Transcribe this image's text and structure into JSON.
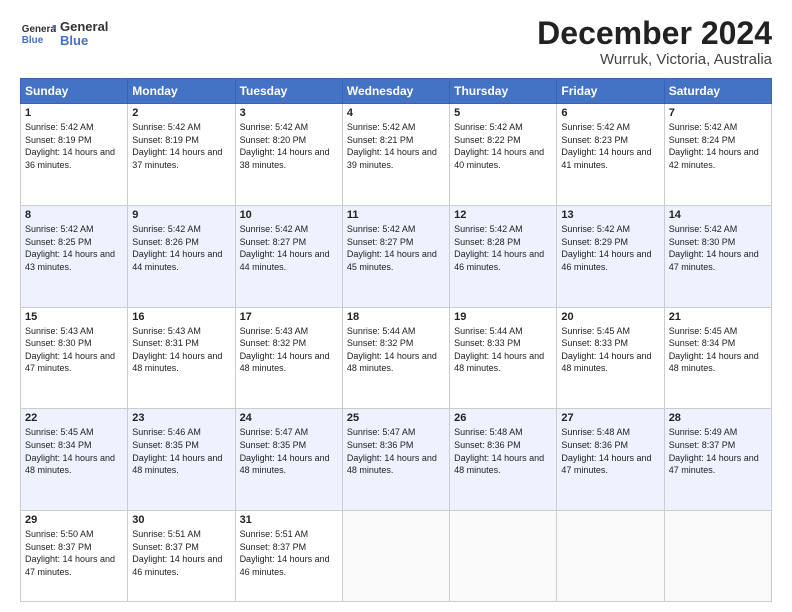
{
  "header": {
    "logo_general": "General",
    "logo_blue": "Blue",
    "title": "December 2024",
    "subtitle": "Wurruk, Victoria, Australia"
  },
  "calendar": {
    "headers": [
      "Sunday",
      "Monday",
      "Tuesday",
      "Wednesday",
      "Thursday",
      "Friday",
      "Saturday"
    ],
    "weeks": [
      [
        null,
        null,
        {
          "day": "3",
          "sunrise": "Sunrise: 5:42 AM",
          "sunset": "Sunset: 8:20 PM",
          "daylight": "Daylight: 14 hours and 38 minutes."
        },
        {
          "day": "4",
          "sunrise": "Sunrise: 5:42 AM",
          "sunset": "Sunset: 8:21 PM",
          "daylight": "Daylight: 14 hours and 39 minutes."
        },
        {
          "day": "5",
          "sunrise": "Sunrise: 5:42 AM",
          "sunset": "Sunset: 8:22 PM",
          "daylight": "Daylight: 14 hours and 40 minutes."
        },
        {
          "day": "6",
          "sunrise": "Sunrise: 5:42 AM",
          "sunset": "Sunset: 8:23 PM",
          "daylight": "Daylight: 14 hours and 41 minutes."
        },
        {
          "day": "7",
          "sunrise": "Sunrise: 5:42 AM",
          "sunset": "Sunset: 8:24 PM",
          "daylight": "Daylight: 14 hours and 42 minutes."
        }
      ],
      [
        {
          "day": "1",
          "sunrise": "Sunrise: 5:42 AM",
          "sunset": "Sunset: 8:19 PM",
          "daylight": "Daylight: 14 hours and 36 minutes."
        },
        {
          "day": "2",
          "sunrise": "Sunrise: 5:42 AM",
          "sunset": "Sunset: 8:19 PM",
          "daylight": "Daylight: 14 hours and 37 minutes."
        },
        {
          "day": "3",
          "sunrise": "Sunrise: 5:42 AM",
          "sunset": "Sunset: 8:20 PM",
          "daylight": "Daylight: 14 hours and 38 minutes."
        },
        {
          "day": "4",
          "sunrise": "Sunrise: 5:42 AM",
          "sunset": "Sunset: 8:21 PM",
          "daylight": "Daylight: 14 hours and 39 minutes."
        },
        {
          "day": "5",
          "sunrise": "Sunrise: 5:42 AM",
          "sunset": "Sunset: 8:22 PM",
          "daylight": "Daylight: 14 hours and 40 minutes."
        },
        {
          "day": "6",
          "sunrise": "Sunrise: 5:42 AM",
          "sunset": "Sunset: 8:23 PM",
          "daylight": "Daylight: 14 hours and 41 minutes."
        },
        {
          "day": "7",
          "sunrise": "Sunrise: 5:42 AM",
          "sunset": "Sunset: 8:24 PM",
          "daylight": "Daylight: 14 hours and 42 minutes."
        }
      ],
      [
        {
          "day": "8",
          "sunrise": "Sunrise: 5:42 AM",
          "sunset": "Sunset: 8:25 PM",
          "daylight": "Daylight: 14 hours and 43 minutes."
        },
        {
          "day": "9",
          "sunrise": "Sunrise: 5:42 AM",
          "sunset": "Sunset: 8:26 PM",
          "daylight": "Daylight: 14 hours and 44 minutes."
        },
        {
          "day": "10",
          "sunrise": "Sunrise: 5:42 AM",
          "sunset": "Sunset: 8:27 PM",
          "daylight": "Daylight: 14 hours and 44 minutes."
        },
        {
          "day": "11",
          "sunrise": "Sunrise: 5:42 AM",
          "sunset": "Sunset: 8:27 PM",
          "daylight": "Daylight: 14 hours and 45 minutes."
        },
        {
          "day": "12",
          "sunrise": "Sunrise: 5:42 AM",
          "sunset": "Sunset: 8:28 PM",
          "daylight": "Daylight: 14 hours and 46 minutes."
        },
        {
          "day": "13",
          "sunrise": "Sunrise: 5:42 AM",
          "sunset": "Sunset: 8:29 PM",
          "daylight": "Daylight: 14 hours and 46 minutes."
        },
        {
          "day": "14",
          "sunrise": "Sunrise: 5:42 AM",
          "sunset": "Sunset: 8:30 PM",
          "daylight": "Daylight: 14 hours and 47 minutes."
        }
      ],
      [
        {
          "day": "15",
          "sunrise": "Sunrise: 5:43 AM",
          "sunset": "Sunset: 8:30 PM",
          "daylight": "Daylight: 14 hours and 47 minutes."
        },
        {
          "day": "16",
          "sunrise": "Sunrise: 5:43 AM",
          "sunset": "Sunset: 8:31 PM",
          "daylight": "Daylight: 14 hours and 48 minutes."
        },
        {
          "day": "17",
          "sunrise": "Sunrise: 5:43 AM",
          "sunset": "Sunset: 8:32 PM",
          "daylight": "Daylight: 14 hours and 48 minutes."
        },
        {
          "day": "18",
          "sunrise": "Sunrise: 5:44 AM",
          "sunset": "Sunset: 8:32 PM",
          "daylight": "Daylight: 14 hours and 48 minutes."
        },
        {
          "day": "19",
          "sunrise": "Sunrise: 5:44 AM",
          "sunset": "Sunset: 8:33 PM",
          "daylight": "Daylight: 14 hours and 48 minutes."
        },
        {
          "day": "20",
          "sunrise": "Sunrise: 5:45 AM",
          "sunset": "Sunset: 8:33 PM",
          "daylight": "Daylight: 14 hours and 48 minutes."
        },
        {
          "day": "21",
          "sunrise": "Sunrise: 5:45 AM",
          "sunset": "Sunset: 8:34 PM",
          "daylight": "Daylight: 14 hours and 48 minutes."
        }
      ],
      [
        {
          "day": "22",
          "sunrise": "Sunrise: 5:45 AM",
          "sunset": "Sunset: 8:34 PM",
          "daylight": "Daylight: 14 hours and 48 minutes."
        },
        {
          "day": "23",
          "sunrise": "Sunrise: 5:46 AM",
          "sunset": "Sunset: 8:35 PM",
          "daylight": "Daylight: 14 hours and 48 minutes."
        },
        {
          "day": "24",
          "sunrise": "Sunrise: 5:47 AM",
          "sunset": "Sunset: 8:35 PM",
          "daylight": "Daylight: 14 hours and 48 minutes."
        },
        {
          "day": "25",
          "sunrise": "Sunrise: 5:47 AM",
          "sunset": "Sunset: 8:36 PM",
          "daylight": "Daylight: 14 hours and 48 minutes."
        },
        {
          "day": "26",
          "sunrise": "Sunrise: 5:48 AM",
          "sunset": "Sunset: 8:36 PM",
          "daylight": "Daylight: 14 hours and 48 minutes."
        },
        {
          "day": "27",
          "sunrise": "Sunrise: 5:48 AM",
          "sunset": "Sunset: 8:36 PM",
          "daylight": "Daylight: 14 hours and 47 minutes."
        },
        {
          "day": "28",
          "sunrise": "Sunrise: 5:49 AM",
          "sunset": "Sunset: 8:37 PM",
          "daylight": "Daylight: 14 hours and 47 minutes."
        }
      ],
      [
        {
          "day": "29",
          "sunrise": "Sunrise: 5:50 AM",
          "sunset": "Sunset: 8:37 PM",
          "daylight": "Daylight: 14 hours and 47 minutes."
        },
        {
          "day": "30",
          "sunrise": "Sunrise: 5:51 AM",
          "sunset": "Sunset: 8:37 PM",
          "daylight": "Daylight: 14 hours and 46 minutes."
        },
        {
          "day": "31",
          "sunrise": "Sunrise: 5:51 AM",
          "sunset": "Sunset: 8:37 PM",
          "daylight": "Daylight: 14 hours and 46 minutes."
        },
        null,
        null,
        null,
        null
      ]
    ],
    "week1_start": [
      {
        "day": "1",
        "sunrise": "Sunrise: 5:42 AM",
        "sunset": "Sunset: 8:19 PM",
        "daylight": "Daylight: 14 hours and 36 minutes."
      },
      {
        "day": "2",
        "sunrise": "Sunrise: 5:42 AM",
        "sunset": "Sunset: 8:19 PM",
        "daylight": "Daylight: 14 hours and 37 minutes."
      }
    ]
  }
}
